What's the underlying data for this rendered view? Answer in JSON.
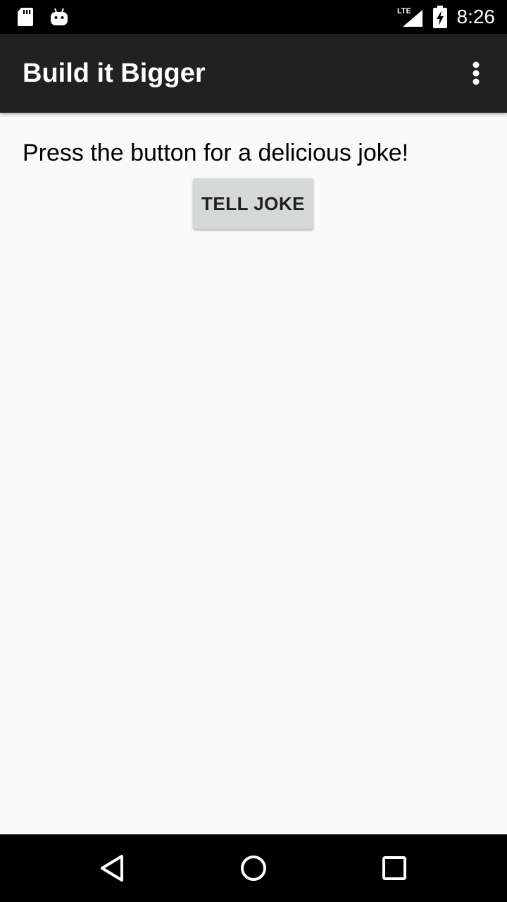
{
  "status_bar": {
    "time": "8:26",
    "network_label": "LTE",
    "icons": [
      "sd-card-icon",
      "android-debug-icon",
      "lte-signal-icon",
      "battery-charging-icon"
    ]
  },
  "app_bar": {
    "title": "Build it Bigger",
    "menu_icon": "overflow-menu-icon"
  },
  "main": {
    "instructions": "Press the button for a delicious joke!",
    "button_label": "TELL JOKE"
  },
  "nav_bar": {
    "icons": [
      "back-icon",
      "home-icon",
      "recents-icon"
    ]
  },
  "colors": {
    "status_bar": "#000000",
    "app_bar": "#212121",
    "background": "#fafafa",
    "button": "#d6d7d7",
    "nav_bar": "#000000"
  }
}
